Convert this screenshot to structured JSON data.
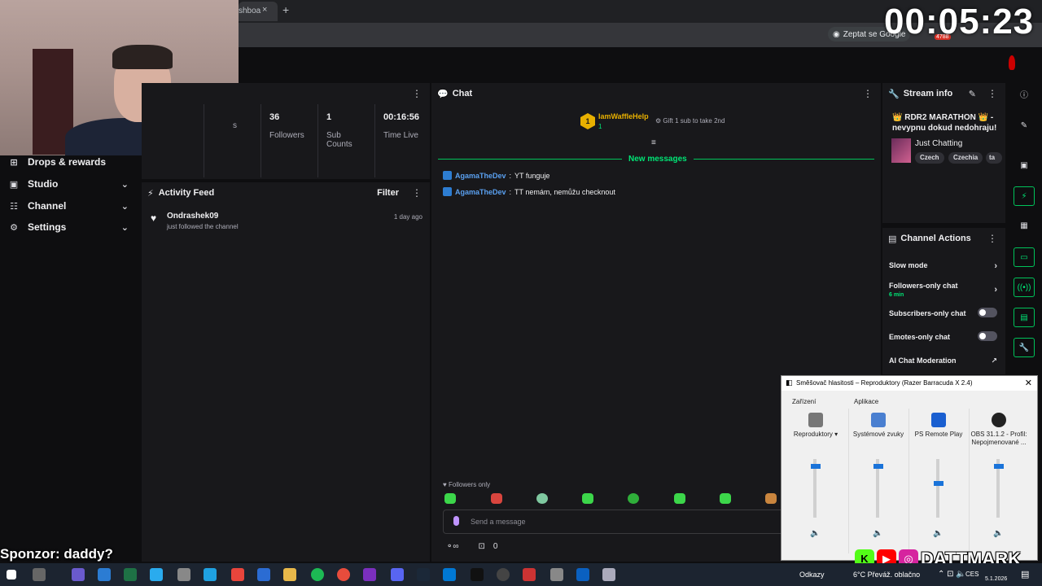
{
  "timer": "00:05:23",
  "browser": {
    "tab_title": "shboa",
    "tab_close": "×",
    "new_tab": "+",
    "google_button": "Zeptat se Google",
    "badge": "4788"
  },
  "sidebar": {
    "items": [
      {
        "label": "Drops & rewards",
        "icon": "drops-icon",
        "glyph": "⊞"
      },
      {
        "label": "Studio",
        "icon": "studio-icon",
        "glyph": "▣"
      },
      {
        "label": "Channel",
        "icon": "channel-icon",
        "glyph": "☷"
      },
      {
        "label": "Settings",
        "icon": "gear-icon",
        "glyph": "⚙"
      }
    ],
    "chevron": "⌄"
  },
  "stats": [
    {
      "value": "",
      "label": "s"
    },
    {
      "value": "36",
      "label": "Followers"
    },
    {
      "value": "1",
      "label": "Sub Counts"
    },
    {
      "value": "00:16:56",
      "label": "Time Live"
    }
  ],
  "activity": {
    "title": "Activity Feed",
    "filter": "Filter",
    "items": [
      {
        "name": "Ondrashek09",
        "action": "just followed the channel",
        "time": "1 day ago"
      }
    ]
  },
  "chat": {
    "title": "Chat",
    "pinned": {
      "rank": "1",
      "name": "IamWaffleHelp",
      "count": "1",
      "gift": "Gift 1 sub to take 2nd"
    },
    "new_messages": "New messages",
    "messages": [
      {
        "user": "AgamaTheDev",
        "text": "YT funguje"
      },
      {
        "user": "AgamaTheDev",
        "text": "TT nemám, nemůžu checknout"
      }
    ],
    "followers_only": "Followers only",
    "placeholder": "Send a message",
    "points": "0"
  },
  "stream_info": {
    "title": "Stream info",
    "stream_title": "👑 RDR2 MARATHON 👑 - nevypnu dokud nedohraju!",
    "category": "Just Chatting",
    "tags": [
      "Czech",
      "Czechia",
      "ta"
    ]
  },
  "channel_actions": {
    "title": "Channel Actions",
    "slow_mode": "Slow mode",
    "followers_chat": "Followers-only chat",
    "followers_chat_sub": "6 min",
    "subs_chat": "Subscribers-only chat",
    "emotes_chat": "Emotes-only chat",
    "ai_moderation": "AI Chat Moderation"
  },
  "mixer": {
    "title": "Směšovač hlasitosti – Reproduktory (Razer Barracuda X 2.4)",
    "device_label": "Zařízení",
    "apps_label": "Aplikace",
    "columns": [
      {
        "name": "Reproduktory ▾",
        "level": 0.88
      },
      {
        "name": "Systémové zvuky",
        "level": 0.88
      },
      {
        "name": "PS Remote Play",
        "level": 0.58
      },
      {
        "name": "OBS 31.1.2 - Profil: Nepojmenované ...",
        "level": 0.88
      }
    ]
  },
  "overlay": {
    "sponsor": "Sponzor: daddy?",
    "social_name": "DATTMARK"
  },
  "taskbar": {
    "links": "Odkazy",
    "weather": "6°C  Převáž. oblačno",
    "lang": "CES",
    "date": "5.1.2026"
  },
  "colors": {
    "accent_green": "#00c35a",
    "twitch_bg": "#0e0e10",
    "panel_bg": "#18181b",
    "username_blue": "#5aa0f0",
    "pinned_gold": "#e8b000"
  }
}
